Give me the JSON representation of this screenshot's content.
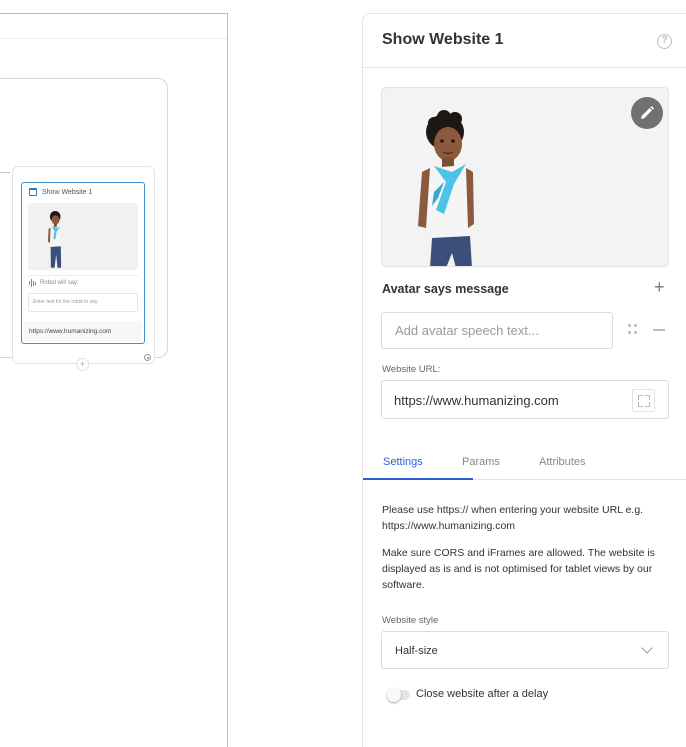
{
  "panel": {
    "title": "Show Website 1",
    "help_icon": "question-mark-circle-icon",
    "avatar": {
      "edit_icon": "pencil-icon"
    },
    "speech": {
      "section_label": "Avatar says message",
      "add_icon": "plus-icon",
      "placeholder": "Add avatar speech text...",
      "drag_icon": "drag-handle-icon",
      "remove_icon": "minus-icon"
    },
    "website_url": {
      "label": "Website URL:",
      "value": "https://www.humanizing.com",
      "expand_icon": "expand-icon"
    },
    "tabs": [
      {
        "label": "Settings",
        "active": true
      },
      {
        "label": "Params",
        "active": false
      },
      {
        "label": "Attributes",
        "active": false
      }
    ],
    "info": [
      "Please use https:// when entering your website URL e.g. https://www.humanizing.com",
      "Make sure CORS and iFrames are allowed. The website is displayed as is and is not optimised for tablet views by our software."
    ],
    "website_style": {
      "label": "Website style",
      "value": "Half-size"
    },
    "close_delay": {
      "label": "Close website after a delay",
      "enabled": false
    }
  },
  "canvas": {
    "node": {
      "title": "Show Website 1",
      "icon": "browser-window-icon",
      "robot_label": "Robot will say:",
      "robot_icon": "sound-wave-icon",
      "input_placeholder": "Enter text for the robot to say",
      "url": "https://www.humanizing.com"
    },
    "add_icon": "plus-icon"
  },
  "colors": {
    "accent": "#2e5fd8",
    "node_border": "#3d8fd0",
    "canvas_border": "#b9b2ee",
    "avatar_skin": "#8b5a3c",
    "avatar_scarf": "#4cc3e8",
    "avatar_jeans": "#3b4f7a"
  }
}
